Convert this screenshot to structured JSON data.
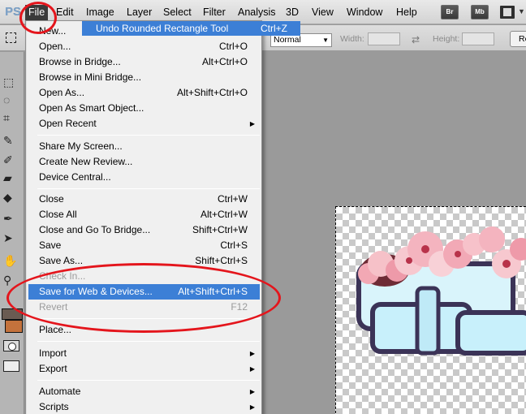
{
  "app": {
    "logo_text": "PS"
  },
  "menubar": {
    "items": [
      "File",
      "Edit",
      "Image",
      "Layer",
      "Select",
      "Filter",
      "Analysis",
      "3D",
      "View",
      "Window",
      "Help"
    ],
    "buttons": [
      "Br",
      "Mb"
    ]
  },
  "options": {
    "style_value": "Normal",
    "width_label": "Width:",
    "height_label": "Height:",
    "refine_label": "Re"
  },
  "undo_popup": {
    "label": "Undo Rounded Rectangle Tool",
    "shortcut": "Ctrl+Z"
  },
  "file_menu": {
    "items": [
      {
        "label": "New...",
        "shortcut": "Ctrl+N"
      },
      {
        "label": "Open...",
        "shortcut": "Ctrl+O"
      },
      {
        "label": "Browse in Bridge...",
        "shortcut": "Alt+Ctrl+O"
      },
      {
        "label": "Browse in Mini Bridge...",
        "shortcut": ""
      },
      {
        "label": "Open As...",
        "shortcut": "Alt+Shift+Ctrl+O"
      },
      {
        "label": "Open As Smart Object...",
        "shortcut": ""
      },
      {
        "label": "Open Recent",
        "shortcut": ""
      },
      {
        "label": "Share My Screen...",
        "shortcut": ""
      },
      {
        "label": "Create New Review...",
        "shortcut": ""
      },
      {
        "label": "Device Central...",
        "shortcut": ""
      },
      {
        "label": "Close",
        "shortcut": "Ctrl+W"
      },
      {
        "label": "Close All",
        "shortcut": "Alt+Ctrl+W"
      },
      {
        "label": "Close and Go To Bridge...",
        "shortcut": "Shift+Ctrl+W"
      },
      {
        "label": "Save",
        "shortcut": "Ctrl+S"
      },
      {
        "label": "Save As...",
        "shortcut": "Shift+Ctrl+S"
      },
      {
        "label": "Check In...",
        "shortcut": ""
      },
      {
        "label": "Save for Web & Devices...",
        "shortcut": "Alt+Shift+Ctrl+S"
      },
      {
        "label": "Revert",
        "shortcut": "F12"
      },
      {
        "label": "Place...",
        "shortcut": ""
      },
      {
        "label": "Import",
        "shortcut": ""
      },
      {
        "label": "Export",
        "shortcut": ""
      },
      {
        "label": "Automate",
        "shortcut": ""
      },
      {
        "label": "Scripts",
        "shortcut": ""
      }
    ]
  },
  "colors": {
    "highlight": "#3c7fd6",
    "annotation": "#e4151c",
    "foreground_swatch": "#6a5b52",
    "background_swatch": "#c4723c"
  }
}
